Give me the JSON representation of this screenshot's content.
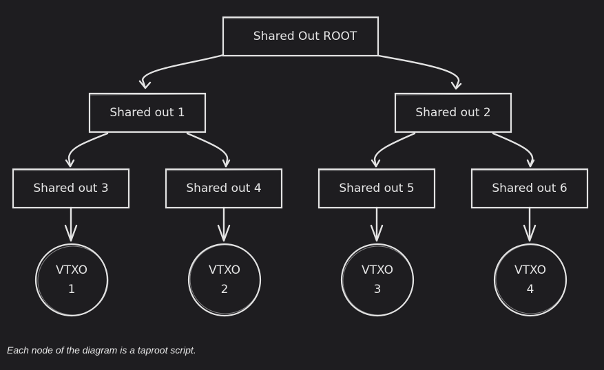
{
  "diagram": {
    "background": "#1e1d20",
    "stroke_color": "#e3e3e3",
    "nodes": [
      {
        "id": "root",
        "label": "Shared Out ROOT",
        "shape": "rect"
      },
      {
        "id": "s1",
        "label": "Shared out 1",
        "shape": "rect"
      },
      {
        "id": "s2",
        "label": "Shared out 2",
        "shape": "rect"
      },
      {
        "id": "s3",
        "label": "Shared out 3",
        "shape": "rect"
      },
      {
        "id": "s4",
        "label": "Shared out 4",
        "shape": "rect"
      },
      {
        "id": "s5",
        "label": "Shared out 5",
        "shape": "rect"
      },
      {
        "id": "s6",
        "label": "Shared out 6",
        "shape": "rect"
      },
      {
        "id": "v1",
        "label_line1": "VTXO",
        "label_line2": "1",
        "shape": "circle"
      },
      {
        "id": "v2",
        "label_line1": "VTXO",
        "label_line2": "2",
        "shape": "circle"
      },
      {
        "id": "v3",
        "label_line1": "VTXO",
        "label_line2": "3",
        "shape": "circle"
      },
      {
        "id": "v4",
        "label_line1": "VTXO",
        "label_line2": "4",
        "shape": "circle"
      }
    ],
    "edges": [
      {
        "from": "root",
        "to": "s1"
      },
      {
        "from": "root",
        "to": "s2"
      },
      {
        "from": "s1",
        "to": "s3"
      },
      {
        "from": "s1",
        "to": "s4"
      },
      {
        "from": "s2",
        "to": "s5"
      },
      {
        "from": "s2",
        "to": "s6"
      },
      {
        "from": "s3",
        "to": "v1"
      },
      {
        "from": "s4",
        "to": "v2"
      },
      {
        "from": "s5",
        "to": "v3"
      },
      {
        "from": "s6",
        "to": "v4"
      }
    ]
  },
  "caption": "Each node of the diagram is a taproot script."
}
